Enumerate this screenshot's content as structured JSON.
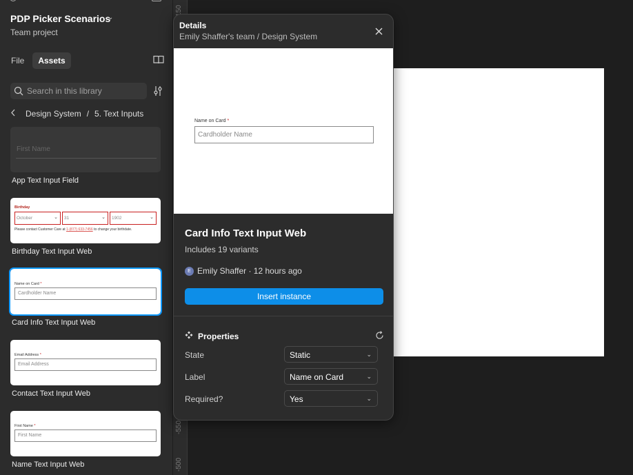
{
  "sidebar": {
    "project_title": "PDP Picker Scenarios",
    "project_subtitle": "Team project",
    "tabs": [
      {
        "label": "File"
      },
      {
        "label": "Assets"
      }
    ],
    "search_placeholder": "Search in this library",
    "breadcrumb": [
      "Design System",
      "/",
      "5. Text Inputs"
    ],
    "components": [
      {
        "name": "App Text Input Field",
        "placeholder": "First Name"
      },
      {
        "name": "Birthday Text Input Web",
        "title": "Birthday",
        "month": "October",
        "day": "31",
        "year": "1902",
        "note_pre": "Please contact Customer Care at ",
        "note_link": "1-(877) 633-7456",
        "note_post": " to change your birthdate."
      },
      {
        "name": "Card Info Text Input Web",
        "label": "Name on Card",
        "placeholder": "Cardholder Name"
      },
      {
        "name": "Contact Text Input Web",
        "label": "Email Address",
        "placeholder": "Email Address"
      },
      {
        "name": "Name Text Input Web",
        "label": "First Name",
        "placeholder": "First Name"
      }
    ],
    "required_mark": "*"
  },
  "ruler": {
    "labels": [
      "-550",
      "-500",
      "150"
    ]
  },
  "details": {
    "title": "Details",
    "subtitle": "Emily Shaffer's team / Design System",
    "preview_label": "Name on Card",
    "preview_placeholder": "Cardholder Name",
    "component_name": "Card Info Text Input Web",
    "variants": "Includes 19 variants",
    "avatar_initial": "E",
    "author": "Emily Shaffer · 12 hours ago",
    "insert_button": "Insert instance",
    "properties_title": "Properties",
    "properties": [
      {
        "label": "State",
        "value": "Static"
      },
      {
        "label": "Label",
        "value": "Name on Card"
      },
      {
        "label": "Required?",
        "value": "Yes"
      }
    ]
  },
  "colors": {
    "accent": "#0d8ee8",
    "selection": "#0d99ff",
    "required": "#c81e1e"
  }
}
